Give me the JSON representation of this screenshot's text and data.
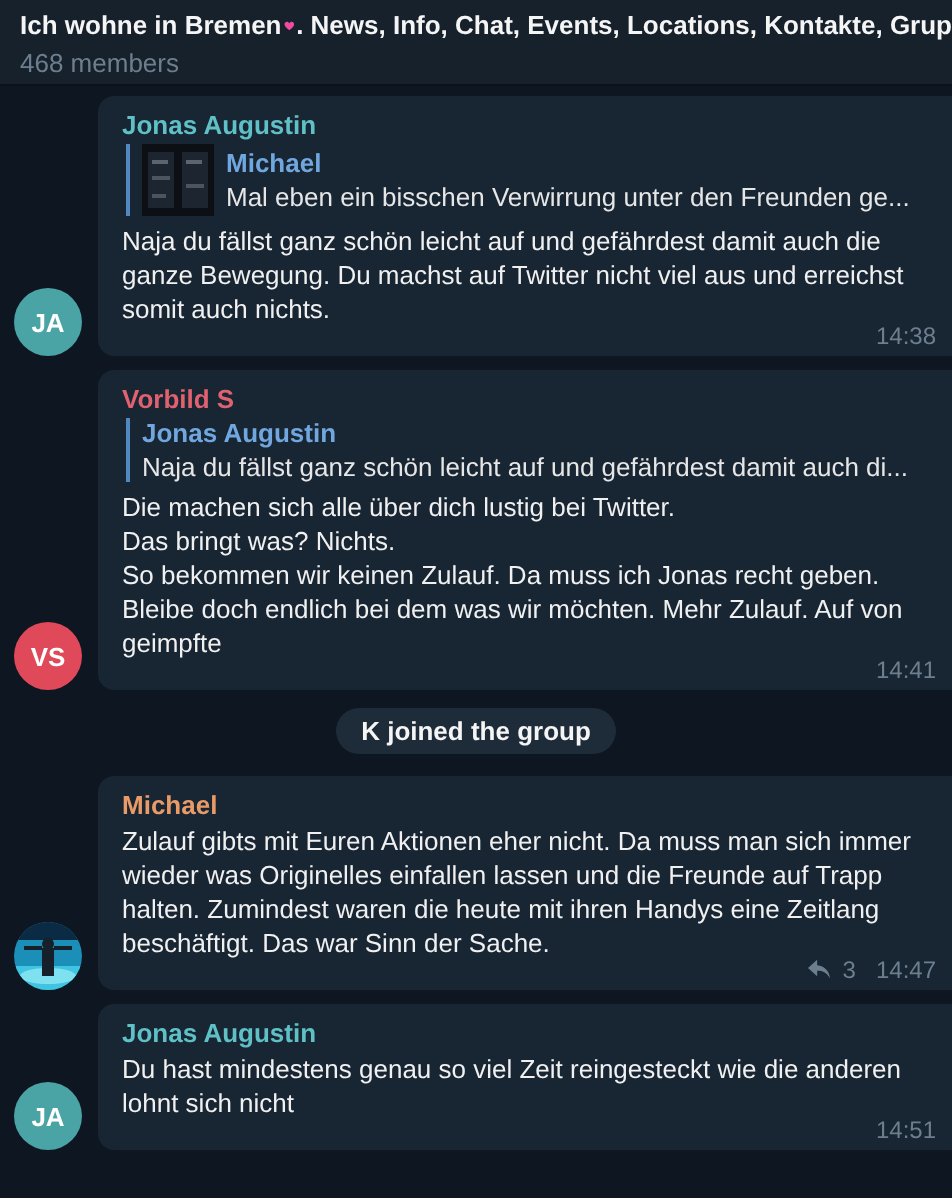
{
  "header": {
    "title_before": "Ich wohne in Bremen",
    "title_after": ". News, Info, Chat, Events, Locations, Kontakte, Grup",
    "subtitle": "468 members"
  },
  "messages": [
    {
      "kind": "message",
      "sender": "Jonas Augustin",
      "color": "#5fc1c6",
      "avatar": {
        "kind": "initials",
        "initials": "JA",
        "color": "#4aa4a6"
      },
      "reply": {
        "author": "Michael",
        "text": "Mal eben ein bisschen Verwirrung unter den Freunden ge...",
        "thumbnail": true
      },
      "text": "Naja du fällst ganz schön leicht auf und gefährdest damit auch die ganze Bewegung. Du machst auf Twitter nicht viel aus und erreichst somit auch nichts.",
      "time": "14:38"
    },
    {
      "kind": "message",
      "sender": "Vorbild S",
      "color": "#e0616f",
      "avatar": {
        "kind": "initials",
        "initials": "VS",
        "color": "#e0495a"
      },
      "reply": {
        "author": "Jonas Augustin",
        "text": "Naja du fällst ganz schön leicht auf und gefährdest damit auch di...",
        "thumbnail": false
      },
      "text": "Die machen sich alle über dich lustig bei Twitter.\nDas bringt was? Nichts.\nSo bekommen wir keinen Zulauf. Da muss ich Jonas recht geben.\nBleibe doch endlich bei dem was wir möchten. Mehr Zulauf. Auf von geimpfte",
      "time": "14:41"
    },
    {
      "kind": "service",
      "text": "K joined the group"
    },
    {
      "kind": "message",
      "sender": "Michael",
      "color": "#e99b67",
      "text": "Zulauf gibts mit Euren Aktionen eher nicht. Da muss man sich immer wieder was Originelles einfallen lassen und die Freunde auf Trapp halten. Zumindest waren die heute mit ihren Handys eine Zeitlang beschäftigt. Das war Sinn der Sache.",
      "replies": "3",
      "time": "14:47"
    },
    {
      "kind": "message",
      "sender": "Jonas Augustin",
      "color": "#5fc1c6",
      "avatar": {
        "kind": "initials",
        "initials": "JA",
        "color": "#4aa4a6"
      },
      "text": "Du hast mindestens genau so viel Zeit reingesteckt wie die anderen lohnt sich nicht",
      "time": "14:51"
    }
  ]
}
